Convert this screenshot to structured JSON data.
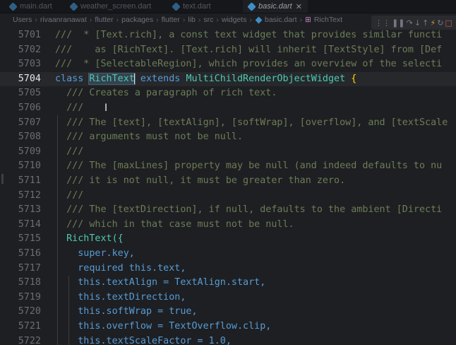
{
  "tabs": [
    {
      "label": "main.dart",
      "active": false
    },
    {
      "label": "weather_screen.dart",
      "active": false
    },
    {
      "label": "text.dart",
      "active": false
    },
    {
      "label": "basic.dart",
      "active": true
    }
  ],
  "breadcrumb": {
    "segments": [
      "Users",
      "rivaanranawat",
      "flutter",
      "packages",
      "flutter",
      "lib",
      "src",
      "widgets"
    ],
    "file": "basic.dart",
    "symbol": "RichText"
  },
  "debug_toolbar": {
    "icons": [
      "drag-handle-icon",
      "pause-icon",
      "step-over-icon",
      "step-into-icon",
      "step-out-icon",
      "hot-reload-icon",
      "restart-icon",
      "stop-icon"
    ]
  },
  "editor": {
    "current_line": "5704",
    "lines": [
      {
        "num": "5701",
        "text": "///  * [Text.rich], a const text widget that provides similar functi"
      },
      {
        "num": "5702",
        "text": "///    as [RichText]. [Text.rich] will inherit [TextStyle] from [Def"
      },
      {
        "num": "5703",
        "text": "///  * [SelectableRegion], which provides an overview of the selecti"
      },
      {
        "num": "5704",
        "text": "class RichText extends MultiChildRenderObjectWidget {"
      },
      {
        "num": "5705",
        "text": "  /// Creates a paragraph of rich text."
      },
      {
        "num": "5706",
        "text": "  ///"
      },
      {
        "num": "5707",
        "text": "  /// The [text], [textAlign], [softWrap], [overflow], and [textScale"
      },
      {
        "num": "5708",
        "text": "  /// arguments must not be null."
      },
      {
        "num": "5709",
        "text": "  ///"
      },
      {
        "num": "5710",
        "text": "  /// The [maxLines] property may be null (and indeed defaults to nu"
      },
      {
        "num": "5711",
        "text": "  /// it is not null, it must be greater than zero."
      },
      {
        "num": "5712",
        "text": "  ///"
      },
      {
        "num": "5713",
        "text": "  /// The [textDirection], if null, defaults to the ambient [Directi"
      },
      {
        "num": "5714",
        "text": "  /// which in that case must not be null."
      },
      {
        "num": "5715",
        "text": "  RichText({"
      },
      {
        "num": "5716",
        "text": "    super.key,"
      },
      {
        "num": "5717",
        "text": "    required this.text,"
      },
      {
        "num": "5718",
        "text": "    this.textAlign = TextAlign.start,"
      },
      {
        "num": "5719",
        "text": "    this.textDirection,"
      },
      {
        "num": "5720",
        "text": "    this.softWrap = true,"
      },
      {
        "num": "5721",
        "text": "    this.overflow = TextOverflow.clip,"
      },
      {
        "num": "5722",
        "text": "    this.textScaleFactor = 1.0,"
      }
    ]
  }
}
